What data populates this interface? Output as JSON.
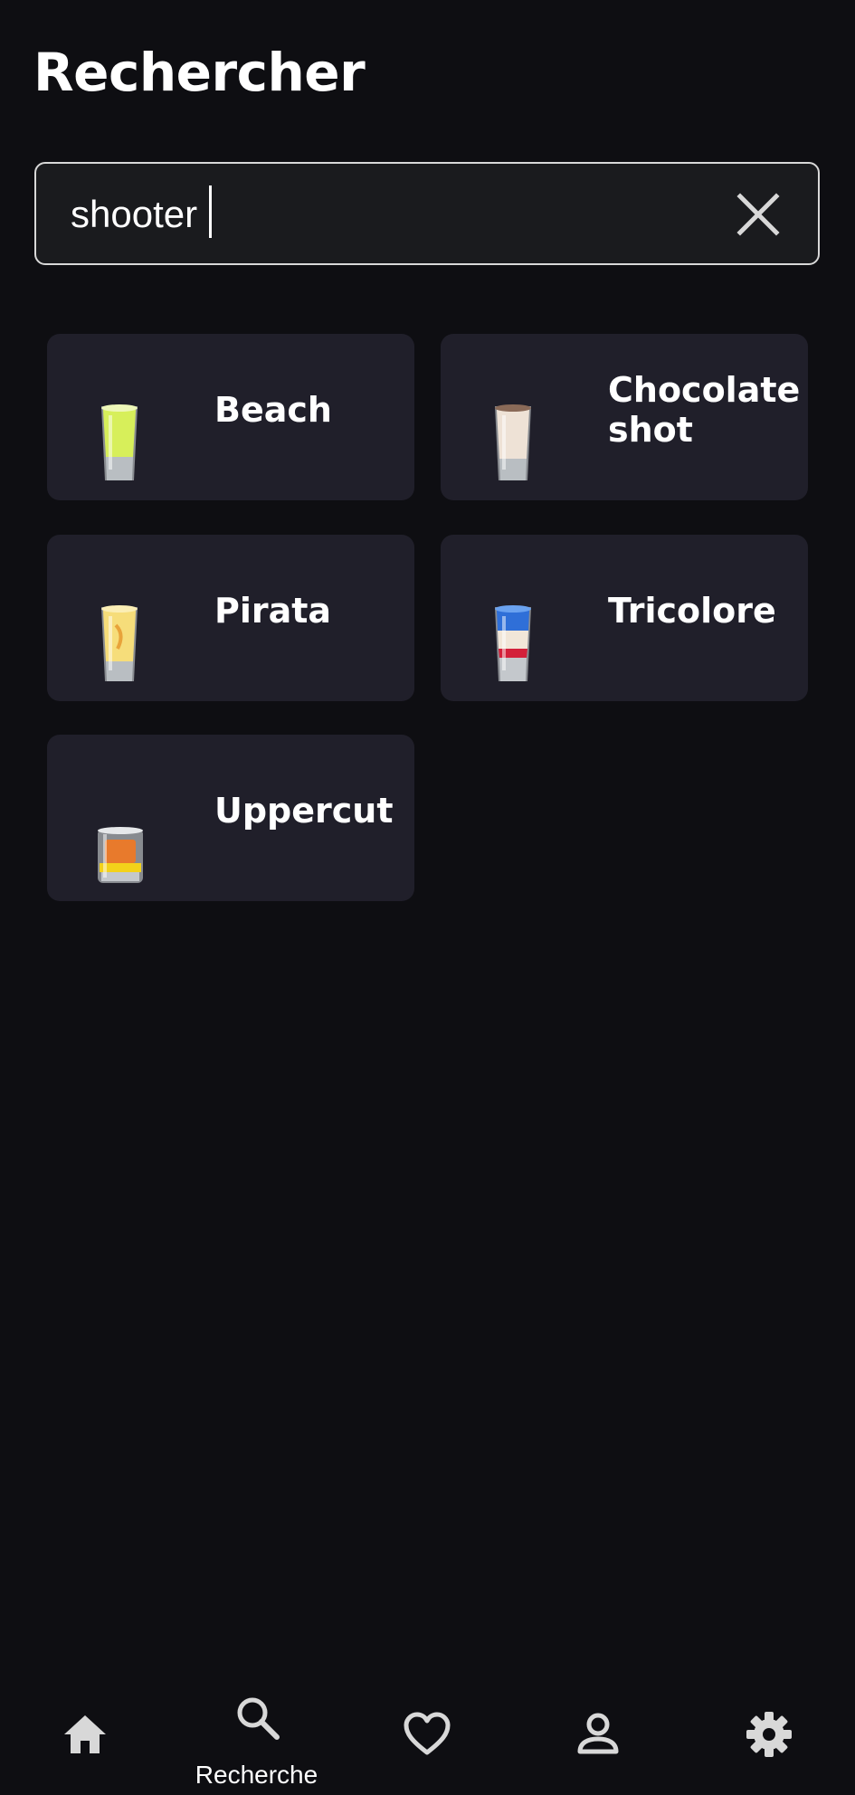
{
  "header": {
    "title": "Rechercher"
  },
  "search": {
    "value": "shooter",
    "clear_icon": "close-icon"
  },
  "results": [
    {
      "name": "Beach",
      "icon": "shot-glass-lime"
    },
    {
      "name": "Chocolate shot",
      "icon": "shot-glass-cream"
    },
    {
      "name": "Pirata",
      "icon": "shot-glass-yellow"
    },
    {
      "name": "Tricolore",
      "icon": "shot-glass-blue-white-red"
    },
    {
      "name": "Uppercut",
      "icon": "shot-glass-orange-yellow"
    }
  ],
  "bottom_nav": {
    "items": [
      {
        "icon": "home-icon",
        "label": ""
      },
      {
        "icon": "search-icon",
        "label": "Recherche",
        "active": true
      },
      {
        "icon": "heart-icon",
        "label": ""
      },
      {
        "icon": "person-icon",
        "label": ""
      },
      {
        "icon": "gear-icon",
        "label": ""
      }
    ]
  },
  "colors": {
    "background": "#0e0e12",
    "card": "#201f2a",
    "search_field": "#1a1b1e",
    "icon": "#d8d8d8"
  }
}
